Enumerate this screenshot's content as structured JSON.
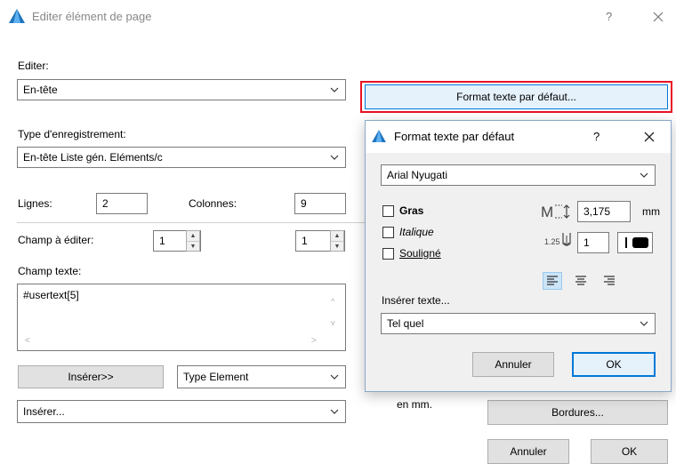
{
  "window": {
    "title": "Editer élément de page",
    "help_label": "?",
    "close_label": "×"
  },
  "main": {
    "editer_label": "Editer:",
    "editer_value": "En-tête",
    "type_label": "Type d'enregistrement:",
    "type_value": "En-tête Liste gén. Eléments/c",
    "lignes_label": "Lignes:",
    "lignes_value": "2",
    "colonnes_label": "Colonnes:",
    "colonnes_value": "9",
    "champ_editer_label": "Champ à éditer:",
    "champ_row_value": "1",
    "champ_col_value": "1",
    "champ_texte_label": "Champ texte:",
    "champ_texte_value": "#usertext[5]",
    "inserer_button": "Insérer>>",
    "type_element_value": "Type Element",
    "inserer_dropdown": "Insérer...",
    "en_mm_label": "en mm.",
    "format_button": "Format texte par défaut...",
    "bordures_button": "Bordures...",
    "annuler_button": "Annuler",
    "ok_button": "OK"
  },
  "subdialog": {
    "title": "Format texte par défaut",
    "help_label": "?",
    "close_label": "×",
    "font_value": "Arial Nyugati",
    "gras_label": "Gras",
    "italique_label": "Italique",
    "souligne_label": "Souligné",
    "size_value": "3,175",
    "size_unit": "mm",
    "spacing_prefix": "1.25",
    "spacing_value": "1",
    "inserer_texte_label": "Insérer texte...",
    "inserer_texte_value": "Tel quel",
    "annuler_button": "Annuler",
    "ok_button": "OK",
    "gras_checked": false,
    "italique_checked": false,
    "souligne_checked": false,
    "alignment_selected": "left"
  },
  "colors": {
    "highlight_border": "#e81123",
    "focus_border": "#0078d7",
    "app_icon": "#1e73be"
  },
  "icons": [
    "archicad-app-icon",
    "help-icon",
    "close-icon",
    "chevron-down-icon",
    "spin-up-icon",
    "spin-down-icon",
    "align-left-icon",
    "align-center-icon",
    "align-right-icon",
    "text-height-icon",
    "line-spacing-icon",
    "pen-color-icon"
  ]
}
